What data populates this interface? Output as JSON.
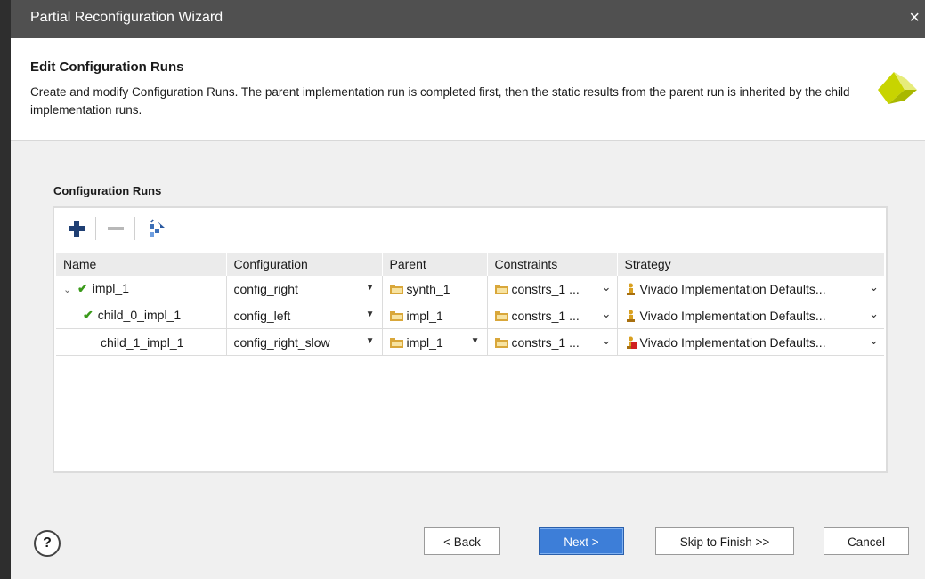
{
  "window": {
    "title": "Partial Reconfiguration Wizard",
    "close_glyph": "×"
  },
  "header": {
    "title": "Edit Configuration Runs",
    "description": "Create and modify Configuration Runs. The parent implementation run is completed first, then the static results from the parent run is inherited by the child implementation runs."
  },
  "section": {
    "label": "Configuration Runs"
  },
  "toolbar": {
    "add_icon": "plus-icon",
    "remove_icon": "minus-icon",
    "auto_create_icon": "auto-create-runs-icon"
  },
  "table": {
    "columns": [
      "Name",
      "Configuration",
      "Parent",
      "Constraints",
      "Strategy"
    ],
    "rows": [
      {
        "name": "impl_1",
        "status": "complete",
        "expanded": true,
        "configuration": "config_right",
        "parent": "synth_1",
        "constraints": "constrs_1 ...",
        "strategy": "Vivado Implementation Defaults..."
      },
      {
        "name": "child_0_impl_1",
        "status": "complete",
        "configuration": "config_left",
        "parent": "impl_1",
        "constraints": "constrs_1 ...",
        "strategy": "Vivado Implementation Defaults..."
      },
      {
        "name": "child_1_impl_1",
        "status": "none",
        "configuration": "config_right_slow",
        "parent": "impl_1",
        "constraints": "constrs_1 ...",
        "strategy": "Vivado Implementation Defaults..."
      }
    ]
  },
  "buttons": {
    "help": "?",
    "back": "< Back",
    "next": "Next >",
    "skip": "Skip to Finish >>",
    "cancel": "Cancel"
  },
  "colors": {
    "titlebar": "#505050",
    "primary_button": "#3d7ed8",
    "check": "#3a9a1a",
    "logo": "#c8d400"
  }
}
